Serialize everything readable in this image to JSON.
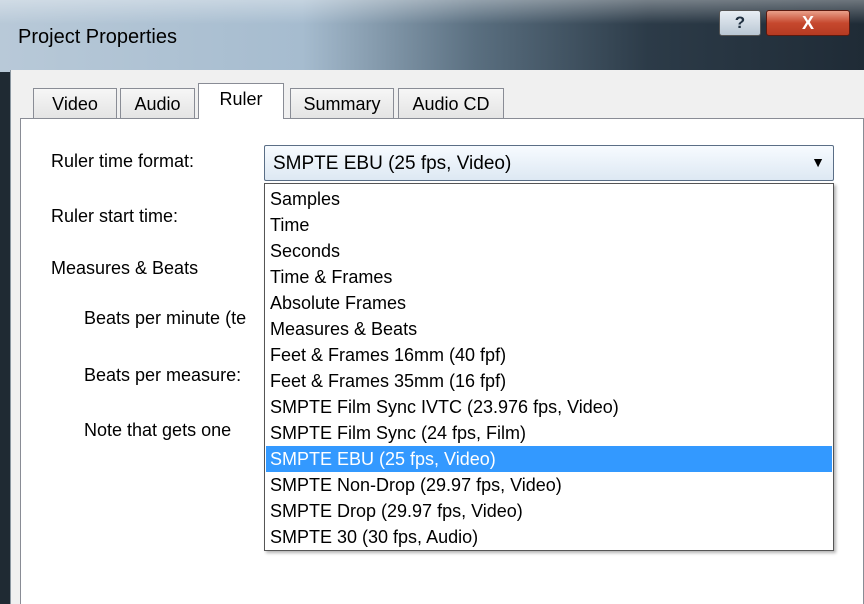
{
  "window": {
    "title": "Project Properties",
    "help_label": "?",
    "close_label": "X"
  },
  "tabs": [
    {
      "label": "Video"
    },
    {
      "label": "Audio"
    },
    {
      "label": "Ruler"
    },
    {
      "label": "Summary"
    },
    {
      "label": "Audio CD"
    }
  ],
  "active_tab": "Ruler",
  "ruler": {
    "time_format_label": "Ruler time format:",
    "time_format_value": "SMPTE EBU (25 fps, Video)",
    "start_time_label": "Ruler start time:",
    "measures_label": "Measures & Beats",
    "bpm_label": "Beats per minute (te",
    "bpmeasure_label": "Beats per measure:",
    "note_label": "Note that gets one"
  },
  "dropdown": {
    "options": [
      "Samples",
      "Time",
      "Seconds",
      "Time & Frames",
      "Absolute Frames",
      "Measures & Beats",
      "Feet & Frames 16mm (40 fpf)",
      "Feet & Frames 35mm (16 fpf)",
      "SMPTE Film Sync IVTC (23.976 fps, Video)",
      "SMPTE Film Sync (24 fps, Film)",
      "SMPTE EBU (25 fps, Video)",
      "SMPTE Non-Drop (29.97 fps, Video)",
      "SMPTE Drop (29.97 fps, Video)",
      "SMPTE 30 (30 fps, Audio)"
    ],
    "selected": "SMPTE EBU (25 fps, Video)"
  },
  "colors": {
    "selection": "#3399ff",
    "close_button": "#c6482e"
  },
  "icons": {
    "dropdown_arrow": "chevron-down-icon"
  }
}
